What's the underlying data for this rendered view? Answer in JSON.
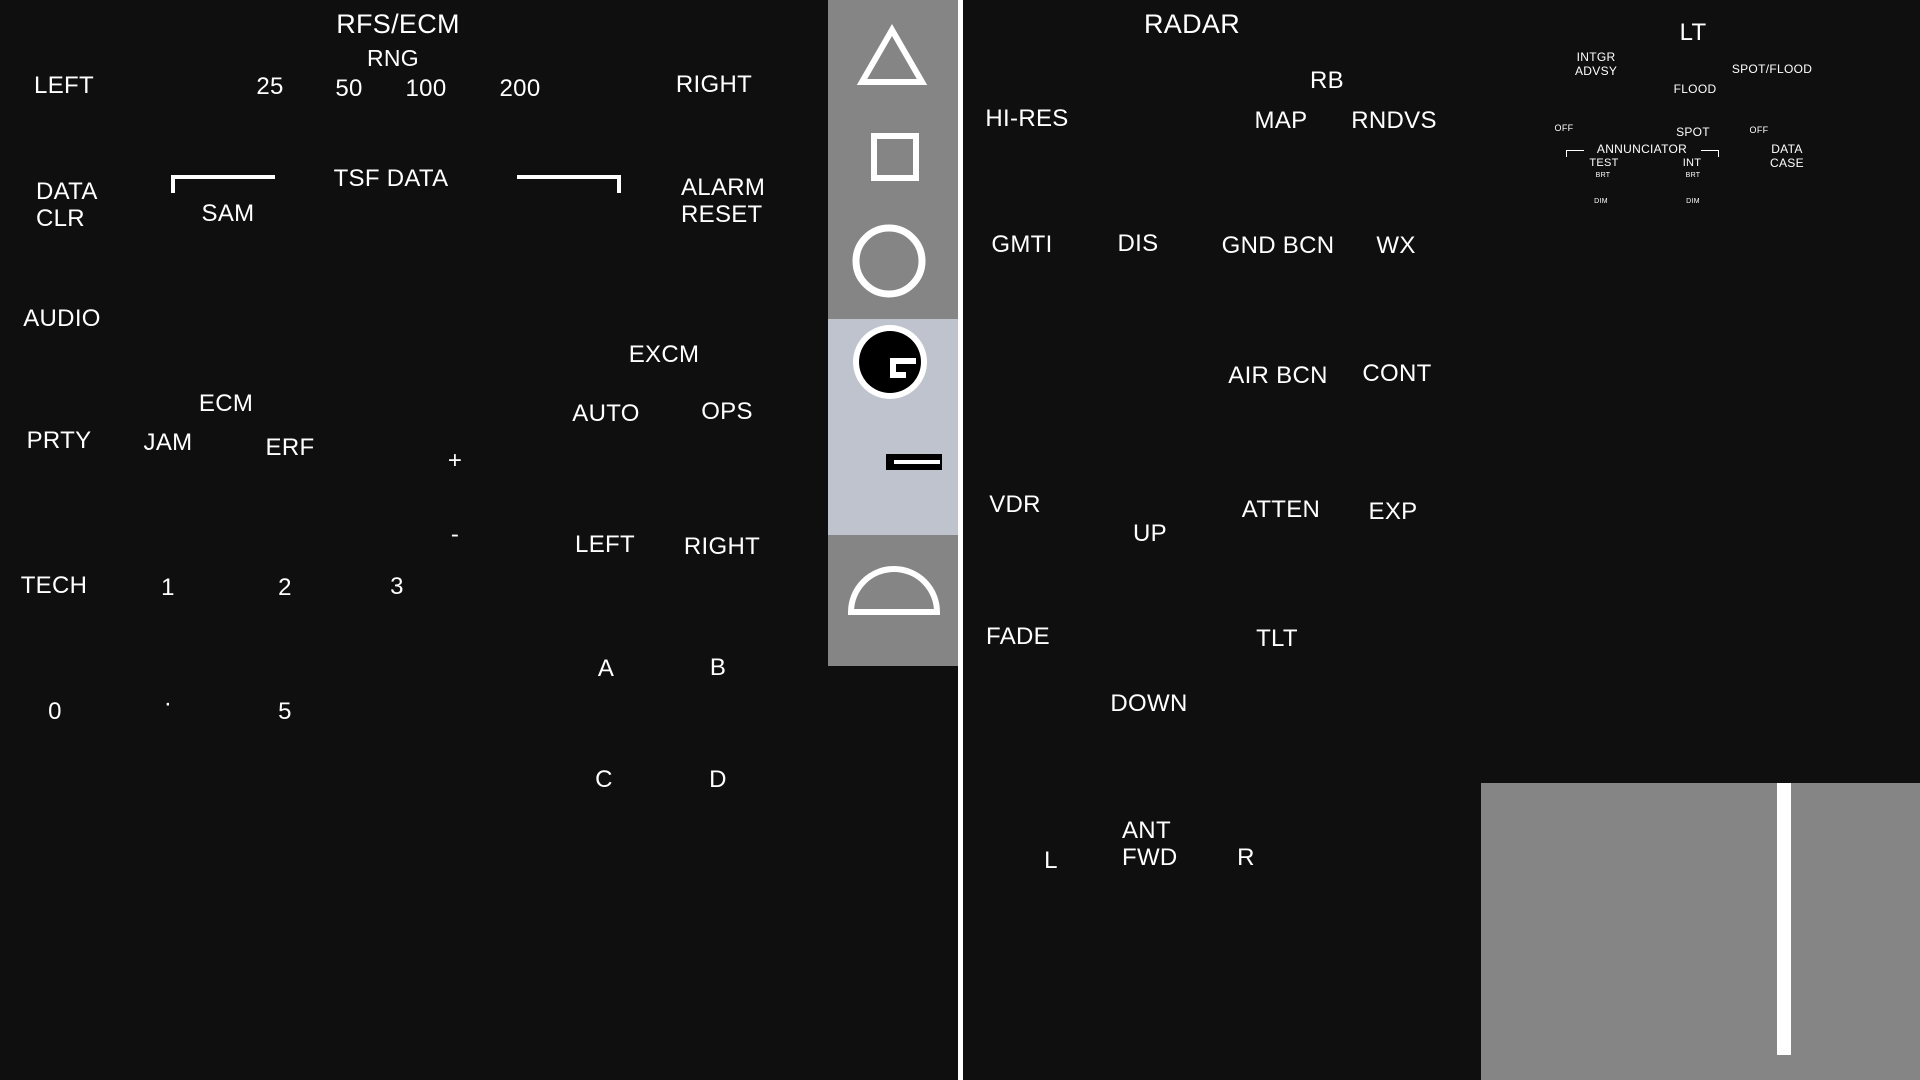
{
  "left_panel": {
    "title": "RFS/ECM",
    "rng_label": "RNG",
    "range_values": [
      "25",
      "50",
      "100",
      "200"
    ],
    "left": "LEFT",
    "right": "RIGHT",
    "data_clr": "DATA\nCLR",
    "sam": "SAM",
    "tsf_data": "TSF DATA",
    "alarm_reset": "ALARM\nRESET",
    "audio": "AUDIO",
    "excm": "EXCM",
    "excm_auto": "AUTO",
    "excm_ops": "OPS",
    "ecm": "ECM",
    "prty": "PRTY",
    "jam": "JAM",
    "erf": "ERF",
    "plus": "+",
    "minus": "-",
    "excm_left": "LEFT",
    "excm_right": "RIGHT",
    "tech": "TECH",
    "keypad_row1": [
      "1",
      "2",
      "3"
    ],
    "keypad_row2": [
      "0",
      "·",
      "5"
    ],
    "abcd": [
      "A",
      "B",
      "C",
      "D"
    ]
  },
  "indicator_strip": {
    "icons": [
      "triangle-icon",
      "square-icon",
      "circle-icon",
      "gauge-icon",
      "dash-icon",
      "half-circle-icon"
    ],
    "colors": {
      "top": "#858585",
      "mid": "#bec3cd",
      "bot": "#858585"
    }
  },
  "radar_panel": {
    "title": "RADAR",
    "rb": "RB",
    "hi_res": "HI-RES",
    "map": "MAP",
    "rndvs": "RNDVS",
    "gmti": "GMTI",
    "dis": "DIS",
    "gnd_bcn": "GND BCN",
    "wx": "WX",
    "air_bcn": "AIR BCN",
    "cont": "CONT",
    "vdr": "VDR",
    "up": "UP",
    "atten": "ATTEN",
    "exp": "EXP",
    "fade": "FADE",
    "tlt": "TLT",
    "down": "DOWN",
    "l": "L",
    "ant_fwd": "ANT\nFWD",
    "r": "R"
  },
  "lt_panel": {
    "title": "LT",
    "intgr_advsy": "INTGR\nADVSY",
    "spot_flood": "SPOT/FLOOD",
    "flood": "FLOOD",
    "off_left": "OFF",
    "spot": "SPOT",
    "off_right": "OFF",
    "annunciator": "ANNUNCIATOR",
    "test": "TEST",
    "int": "INT",
    "data_case": "DATA\nCASE",
    "brt_left": "BRT",
    "brt_right": "BRT",
    "dim_left": "DIM",
    "dim_right": "DIM"
  },
  "colors": {
    "background": "#0f0f0f",
    "text": "#ffffff",
    "display_box": "#858585"
  }
}
